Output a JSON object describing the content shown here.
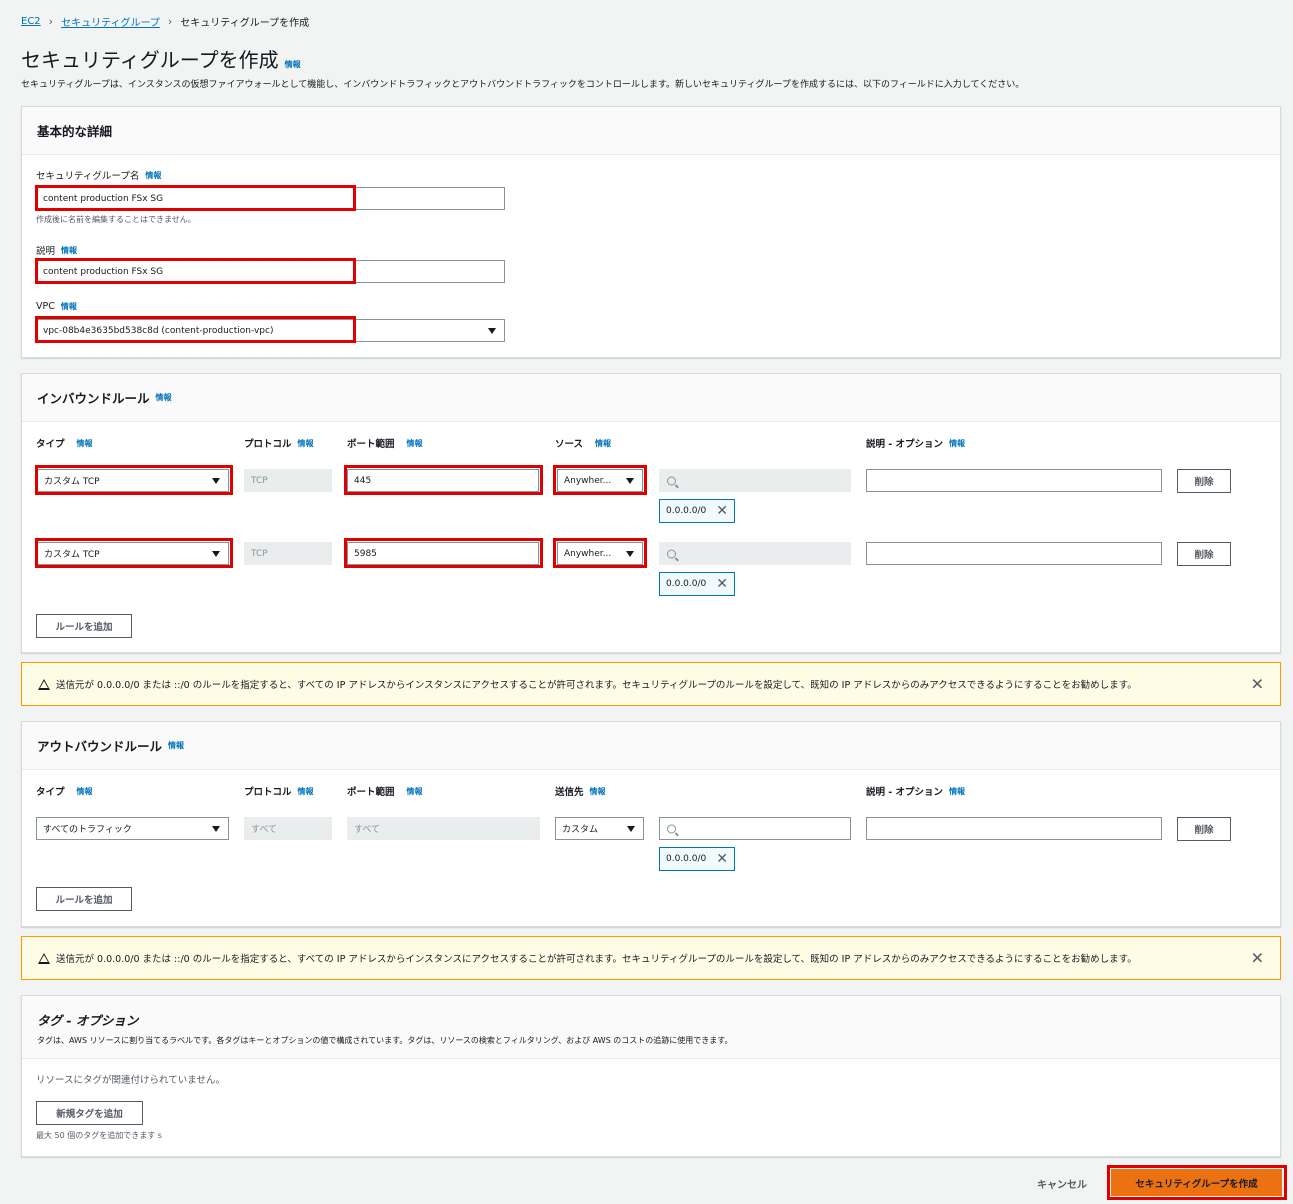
{
  "breadcrumb": {
    "items": [
      "EC2",
      "セキュリティグループ"
    ],
    "current": "セキュリティグループを作成"
  },
  "page": {
    "title": "セキュリティグループを作成",
    "info": "情報",
    "description": "セキュリティグループは、インスタンスの仮想ファイアウォールとして機能し、インバウンドトラフィックとアウトバウンドトラフィックをコントロールします。新しいセキュリティグループを作成するには、以下のフィールドに入力してください。"
  },
  "basic": {
    "title": "基本的な詳細",
    "name_label": "セキュリティグループ名",
    "name_value": "content production FSx SG",
    "name_hint": "作成後に名前を編集することはできません。",
    "desc_label": "説明",
    "desc_value": "content production FSx SG",
    "vpc_label": "VPC",
    "vpc_value": "vpc-08b4e3635bd538c8d (content-production-vpc)"
  },
  "inbound": {
    "title": "インバウンドルール",
    "headers": {
      "type": "タイプ",
      "protocol": "プロトコル",
      "port": "ポート範囲",
      "source": "ソース",
      "desc": "説明 - オプション"
    },
    "rules": [
      {
        "type": "カスタム TCP",
        "protocol": "TCP",
        "port": "445",
        "source": "Anywher...",
        "cidr": "0.0.0.0/0",
        "delete": "削除"
      },
      {
        "type": "カスタム TCP",
        "protocol": "TCP",
        "port": "5985",
        "source": "Anywher...",
        "cidr": "0.0.0.0/0",
        "delete": "削除"
      }
    ],
    "add_rule": "ルールを追加"
  },
  "warning": "送信元が 0.0.0.0/0 または ::/0 のルールを指定すると、すべての IP アドレスからインスタンスにアクセスすることが許可されます。セキュリティグループのルールを設定して、既知の IP アドレスからのみアクセスできるようにすることをお勧めします。",
  "outbound": {
    "title": "アウトバウンドルール",
    "headers": {
      "type": "タイプ",
      "protocol": "プロトコル",
      "port": "ポート範囲",
      "dest": "送信先",
      "desc": "説明 - オプション"
    },
    "rule": {
      "type": "すべてのトラフィック",
      "protocol": "すべて",
      "port": "すべて",
      "dest": "カスタム",
      "cidr": "0.0.0.0/0",
      "delete": "削除"
    },
    "add_rule": "ルールを追加"
  },
  "tags": {
    "title": "タグ - オプション",
    "description": "タグは、AWS リソースに割り当てるラベルです。各タグはキーとオプションの値で構成されています。タグは、リソースの検索とフィルタリング、および AWS のコストの追跡に使用できます。",
    "empty": "リソースにタグが関連付けられていません。",
    "add_tag": "新規タグを追加",
    "limit": "最大 50 個のタグを追加できます s"
  },
  "footer": {
    "cancel": "キャンセル",
    "create": "セキュリティグループを作成"
  }
}
